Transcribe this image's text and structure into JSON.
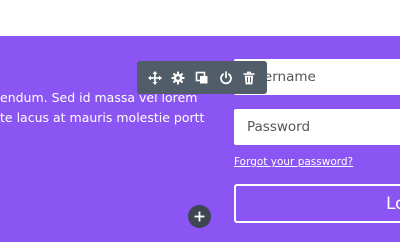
{
  "body_text": {
    "line1": "endum. Sed id massa vel lorem",
    "line2": "te lacus at mauris molestie porttitor."
  },
  "login_form": {
    "username_placeholder": "Username",
    "password_placeholder": "Password",
    "forgot_link": "Forgot your password?",
    "login_button": "Login"
  },
  "toolbar": {
    "icons": [
      "move-icon",
      "settings-icon",
      "duplicate-icon",
      "power-icon",
      "trash-icon"
    ]
  },
  "add_module": {
    "icon": "plus-icon"
  },
  "colors": {
    "section_background": "#8a55f3",
    "toolbar_background": "#515d68",
    "add_button_background": "#3d4651",
    "text": "#ffffff"
  }
}
